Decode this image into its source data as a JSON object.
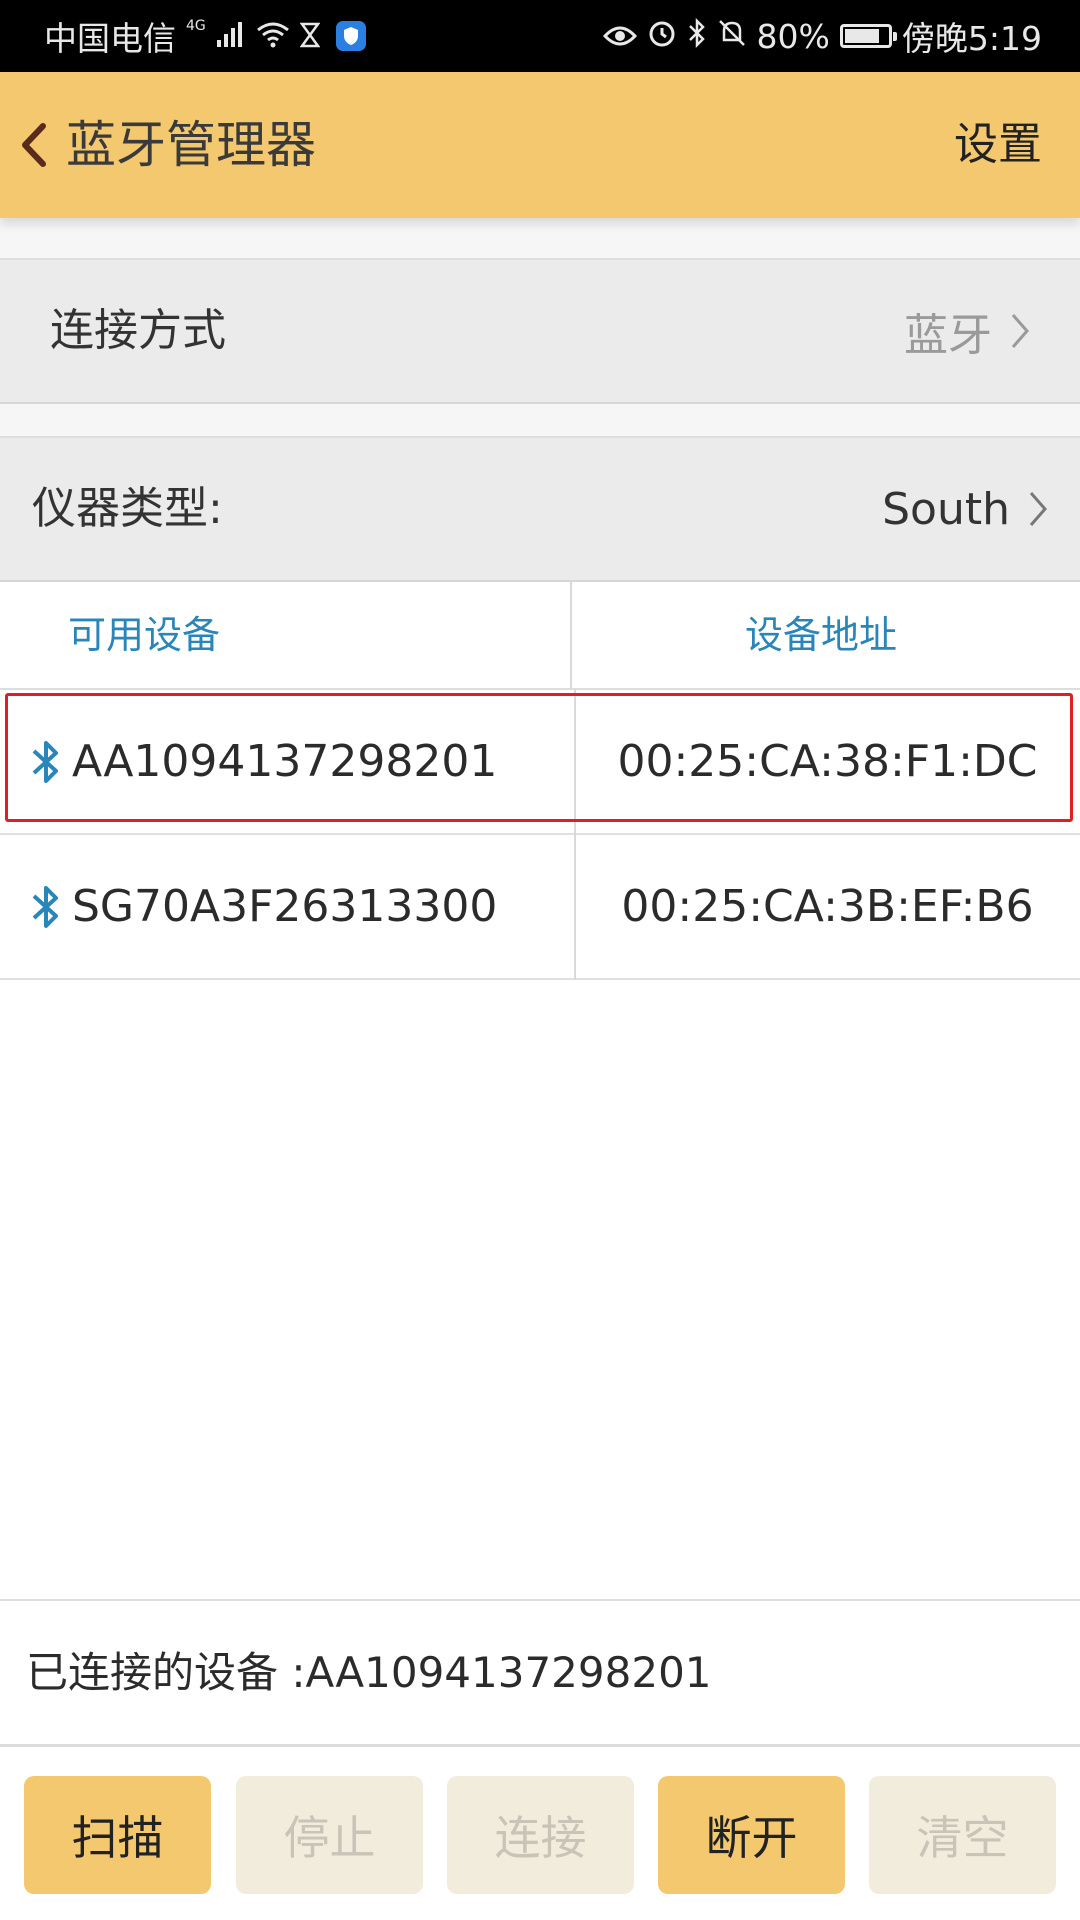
{
  "status_bar": {
    "carrier": "中国电信",
    "network": "4G",
    "battery": "80%",
    "battery_level": 0.8,
    "time": "傍晚5:19"
  },
  "app_bar": {
    "title": "蓝牙管理器",
    "settings_label": "设置",
    "back_icon": "chevron-left-icon"
  },
  "connection_method": {
    "label": "连接方式",
    "value": "蓝牙"
  },
  "instrument_type": {
    "label": "仪器类型:",
    "value": "South"
  },
  "device_table": {
    "headers": [
      "可用设备",
      "设备地址"
    ],
    "rows": [
      {
        "name": "AA1094137298201",
        "address": "00:25:CA:38:F1:DC",
        "selected": true
      },
      {
        "name": "SG70A3F26313300",
        "address": "00:25:CA:3B:EF:B6",
        "selected": false
      }
    ]
  },
  "connected_device": {
    "text": "已连接的设备 :AA1094137298201"
  },
  "buttons": [
    {
      "label": "扫描",
      "enabled": true
    },
    {
      "label": "停止",
      "enabled": false
    },
    {
      "label": "连接",
      "enabled": false
    },
    {
      "label": "断开",
      "enabled": true
    },
    {
      "label": "清空",
      "enabled": false
    }
  ],
  "colors": {
    "accent": "#f4c86e",
    "header_text": "#2a85b8",
    "bluetooth_icon": "#2a85b8",
    "highlight_border": "#e02020",
    "disabled_button": "#f2ecdc"
  }
}
